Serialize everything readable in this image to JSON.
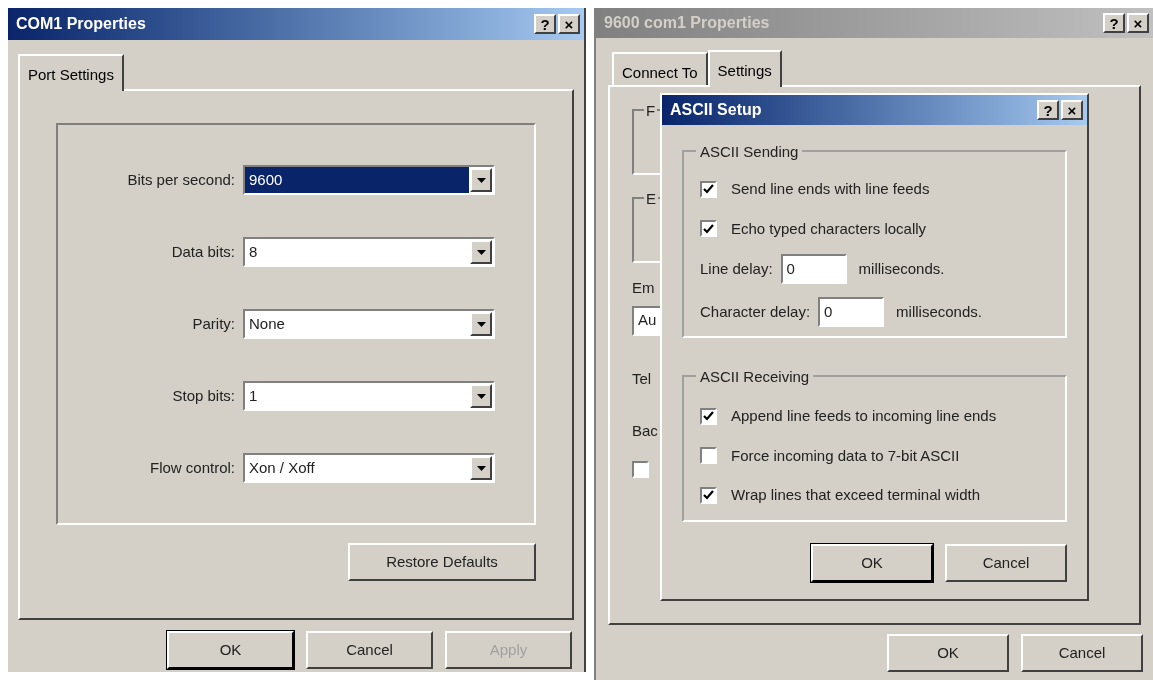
{
  "com1_properties": {
    "title": "COM1 Properties",
    "active": true,
    "title_buttons": [
      "?",
      "×"
    ],
    "tabs": [
      {
        "label": "Port Settings",
        "selected": true
      }
    ],
    "fields": [
      {
        "label": "Bits per second:",
        "value": "9600",
        "focused": true
      },
      {
        "label": "Data bits:",
        "value": "8",
        "focused": false
      },
      {
        "label": "Parity:",
        "value": "None",
        "focused": false
      },
      {
        "label": "Stop bits:",
        "value": "1",
        "focused": false
      },
      {
        "label": "Flow control:",
        "value": "Xon / Xoff",
        "focused": false
      }
    ],
    "restore_button": "Restore Defaults",
    "buttons": [
      {
        "label": "OK",
        "default": true,
        "disabled": false
      },
      {
        "label": "Cancel",
        "default": false,
        "disabled": false
      },
      {
        "label": "Apply",
        "default": false,
        "disabled": true
      }
    ]
  },
  "com1_9600_properties": {
    "title": "9600 com1 Properties",
    "active": false,
    "title_buttons": [
      "?",
      "×"
    ],
    "tabs": [
      {
        "label": "Connect To",
        "selected": false
      },
      {
        "label": "Settings",
        "selected": true
      }
    ],
    "partial_group_labels": [
      "F",
      "E"
    ],
    "emulation_label": "Em",
    "emulation_value": "Au",
    "telnet_label": "Tel",
    "backscroll_label": "Bac",
    "checkbox": {
      "checked": false
    },
    "buttons": [
      {
        "label": "OK",
        "default": false,
        "disabled": false
      },
      {
        "label": "Cancel",
        "default": false,
        "disabled": false
      }
    ]
  },
  "ascii_setup": {
    "title": "ASCII Setup",
    "active": true,
    "title_buttons": [
      "?",
      "×"
    ],
    "sending": {
      "label": "ASCII Sending",
      "options": [
        {
          "label": "Send line ends with line feeds",
          "checked": true
        },
        {
          "label": "Echo typed characters locally",
          "checked": true
        }
      ],
      "delays": [
        {
          "label": "Line delay:",
          "value": "0",
          "unit": "milliseconds."
        },
        {
          "label": "Character delay:",
          "value": "0",
          "unit": "milliseconds."
        }
      ]
    },
    "receiving": {
      "label": "ASCII Receiving",
      "options": [
        {
          "label": "Append line feeds to incoming line ends",
          "checked": true
        },
        {
          "label": "Force incoming data to 7-bit ASCII",
          "checked": false
        },
        {
          "label": "Wrap lines that exceed terminal width",
          "checked": true
        }
      ]
    },
    "buttons": [
      {
        "label": "OK",
        "default": true,
        "disabled": false
      },
      {
        "label": "Cancel",
        "default": false,
        "disabled": false
      }
    ]
  }
}
